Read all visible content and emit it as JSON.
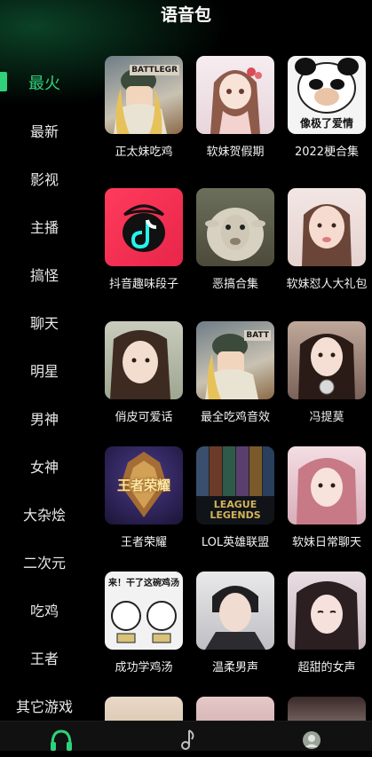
{
  "header": {
    "title": "语音包"
  },
  "sidebar": {
    "items": [
      {
        "label": "最火",
        "active": true
      },
      {
        "label": "最新"
      },
      {
        "label": "影视"
      },
      {
        "label": "主播"
      },
      {
        "label": "搞怪"
      },
      {
        "label": "聊天"
      },
      {
        "label": "明星"
      },
      {
        "label": "男神"
      },
      {
        "label": "女神"
      },
      {
        "label": "大杂烩"
      },
      {
        "label": "二次元"
      },
      {
        "label": "吃鸡"
      },
      {
        "label": "王者"
      },
      {
        "label": "其它游戏"
      }
    ]
  },
  "grid": {
    "items": [
      {
        "label": "正太妹吃鸡",
        "thumb_text": "BATTLEGR"
      },
      {
        "label": "软妹贺假期",
        "thumb_text": ""
      },
      {
        "label": "2022梗合集",
        "thumb_text": "像极了爱情"
      },
      {
        "label": "抖音趣味段子",
        "thumb_text": ""
      },
      {
        "label": "恶搞合集",
        "thumb_text": ""
      },
      {
        "label": "软妹怼人大礼包",
        "thumb_text": ""
      },
      {
        "label": "俏皮可爱话",
        "thumb_text": ""
      },
      {
        "label": "最全吃鸡音效",
        "thumb_text": "BATT"
      },
      {
        "label": "冯提莫",
        "thumb_text": ""
      },
      {
        "label": "王者荣耀",
        "thumb_text": "王者荣耀"
      },
      {
        "label": "LOL英雄联盟",
        "thumb_text": "LEAGUE LEGENDS"
      },
      {
        "label": "软妹日常聊天",
        "thumb_text": ""
      },
      {
        "label": "成功学鸡汤",
        "thumb_text": "来！干了这碗鸡汤"
      },
      {
        "label": "温柔男声",
        "thumb_text": ""
      },
      {
        "label": "超甜的女声",
        "thumb_text": ""
      }
    ]
  },
  "tabbar": {
    "items": [
      {
        "icon": "headphones-icon"
      },
      {
        "icon": "music-note-icon"
      },
      {
        "icon": "profile-icon"
      }
    ]
  },
  "colors": {
    "accent": "#2fd17a",
    "background": "#000000"
  }
}
